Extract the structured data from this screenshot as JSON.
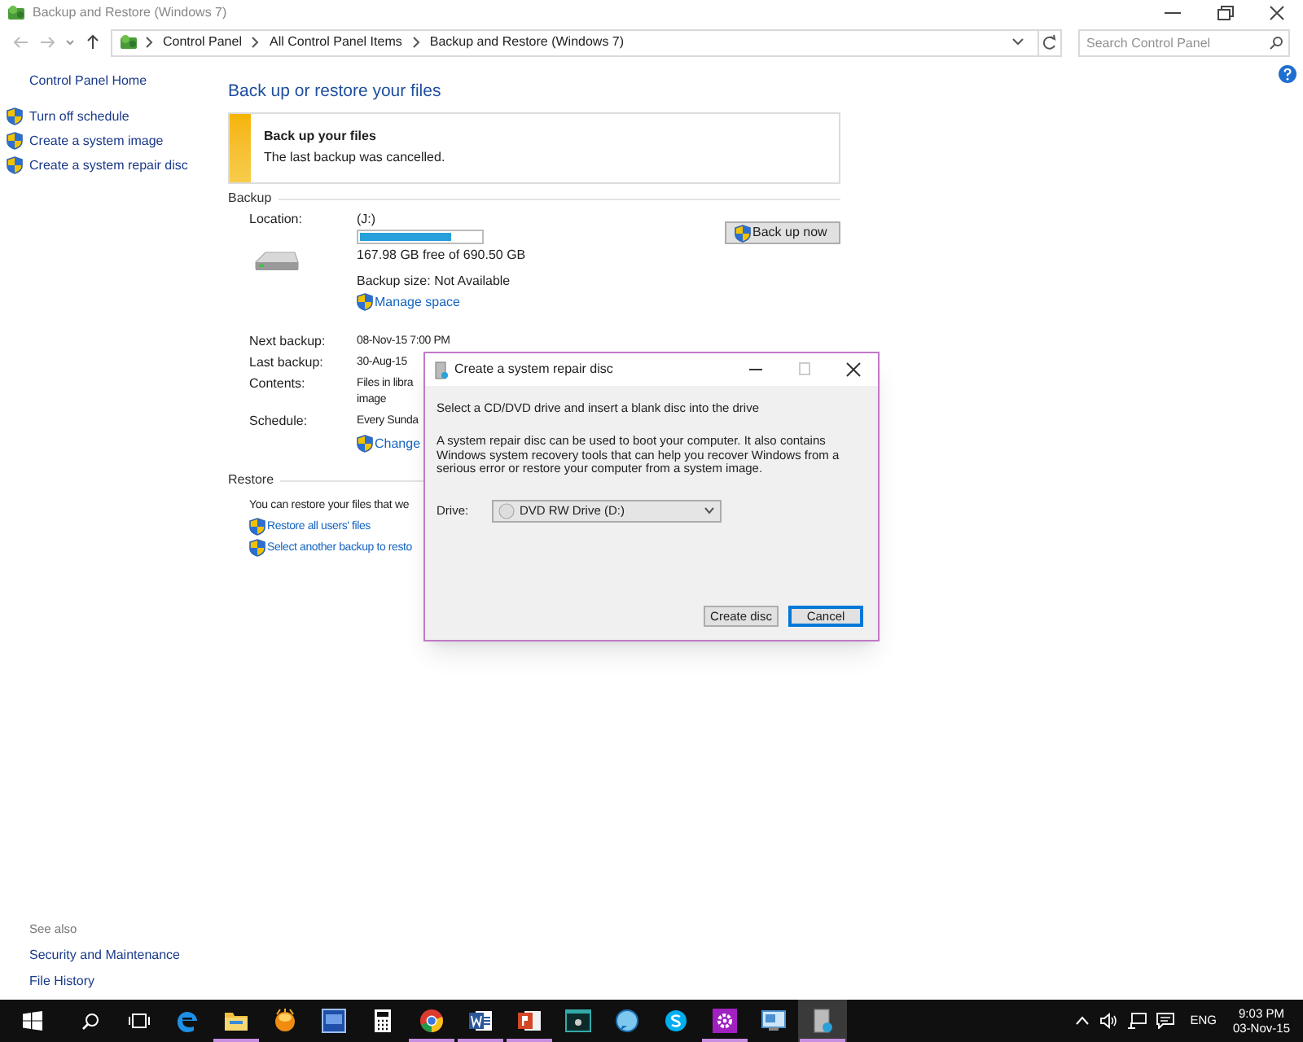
{
  "window": {
    "title": "Backup and Restore (Windows 7)"
  },
  "address_bar": {
    "path": [
      "Control Panel",
      "All Control Panel Items",
      "Backup and Restore (Windows 7)"
    ]
  },
  "search": {
    "placeholder": "Search Control Panel"
  },
  "sidebar": {
    "home": "Control Panel Home",
    "tasks": [
      "Turn off schedule",
      "Create a system image",
      "Create a system repair disc"
    ],
    "see_also_heading": "See also",
    "see_also": [
      "Security and Maintenance",
      "File History"
    ]
  },
  "page_title": "Back up or restore your files",
  "notice": {
    "title": "Back up your files",
    "message": "The last backup was cancelled."
  },
  "backup": {
    "heading": "Backup",
    "location_label": "Location:",
    "drive": "(J:)",
    "level": 0.75,
    "free_space": "167.98 GB free of 690.50 GB",
    "backup_size": "Backup size: Not Available",
    "manage_link": "Manage space",
    "button": "Back up now",
    "details": [
      {
        "label": "Next backup:",
        "lines": [
          "08-Nov-15 7:00 PM"
        ]
      },
      {
        "label": "Last backup:",
        "lines": [
          "30-Aug-15"
        ]
      },
      {
        "label": "Contents:",
        "lines": [
          "Files in libra",
          "image"
        ]
      },
      {
        "label": "Schedule:",
        "lines": [
          "Every Sunda"
        ]
      }
    ],
    "change_link": "Change"
  },
  "restore": {
    "heading": "Restore",
    "text": "You can restore your files that we",
    "links": [
      "Restore all users' files",
      "Select another backup to resto"
    ]
  },
  "dialog": {
    "title": "Create a system repair disc",
    "instruction": "Select a CD/DVD drive and insert a blank disc into the drive",
    "description": "A system repair disc can be used to boot your computer. It also contains Windows system recovery tools that can help you recover Windows from a serious error or restore your computer from a system image.",
    "drive_label": "Drive:",
    "drive_value": "DVD RW Drive (D:)",
    "buttons": [
      {
        "label": "Create disc",
        "default": false
      },
      {
        "label": "Cancel",
        "default": true
      }
    ]
  },
  "taskbar": {
    "apps": [
      {
        "kind": "edge",
        "running": false,
        "selected": false
      },
      {
        "kind": "folder",
        "running": true,
        "selected": false
      },
      {
        "kind": "ball",
        "running": false,
        "selected": false
      },
      {
        "kind": "tile",
        "running": false,
        "selected": false
      },
      {
        "kind": "calculator",
        "running": false,
        "selected": false
      },
      {
        "kind": "chrome",
        "running": true,
        "selected": false
      },
      {
        "kind": "word",
        "running": true,
        "selected": false
      },
      {
        "kind": "slides",
        "running": true,
        "selected": false
      },
      {
        "kind": "terminal",
        "running": false,
        "selected": false
      },
      {
        "kind": "bubble",
        "running": false,
        "selected": false
      },
      {
        "kind": "skype",
        "running": false,
        "selected": false
      },
      {
        "kind": "gear",
        "running": true,
        "selected": false
      },
      {
        "kind": "monitor",
        "running": false,
        "selected": false
      },
      {
        "kind": "disc",
        "running": true,
        "selected": true
      }
    ],
    "language": "ENG",
    "time": "9:03 PM",
    "date": "03-Nov-15"
  }
}
